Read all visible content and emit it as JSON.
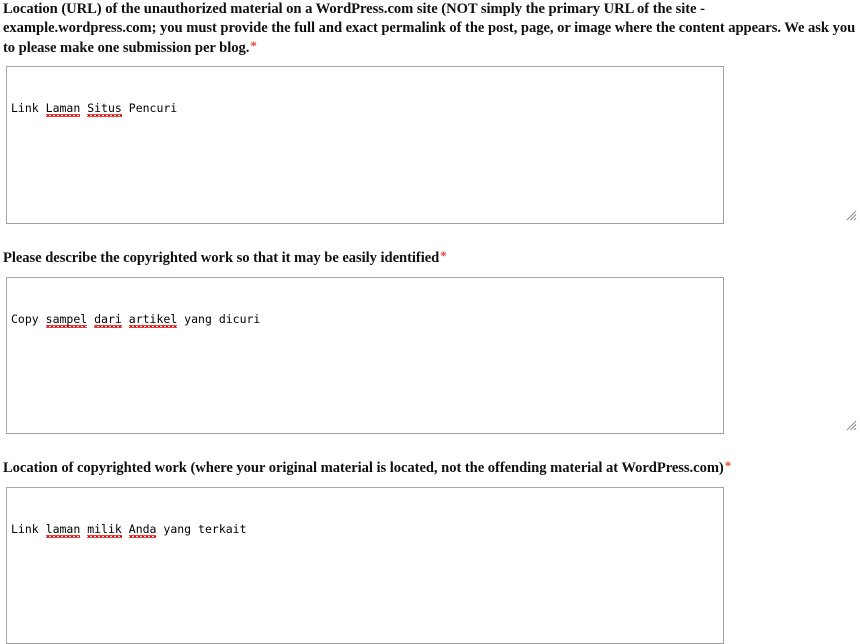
{
  "page": {
    "title": "WordPress.com DMCA Notice Form",
    "required_marker": "*",
    "accent_required_color": "#e8453c",
    "border_color": "#a3a3a3",
    "spellcheck_underline_color": "#e00000",
    "background_color": "#ffffff"
  },
  "fields": [
    {
      "id": "unauthorized-material-url",
      "label": "Location (URL) of the unauthorized material on a WordPress.com site (NOT simply the primary URL of the site - example.wordpress.com; you must provide the full and exact permalink of the post, page, or image where the content appears. We ask you to please make one submission per blog.",
      "required": true,
      "value": "Link Laman Situs Pencuri",
      "value_tokens": [
        {
          "text": "Link",
          "misspelled": false
        },
        {
          "text": " ",
          "misspelled": false
        },
        {
          "text": "Laman",
          "misspelled": true
        },
        {
          "text": " ",
          "misspelled": false
        },
        {
          "text": "Situs",
          "misspelled": true
        },
        {
          "text": " ",
          "misspelled": false
        },
        {
          "text": "Pencuri",
          "misspelled": false
        }
      ],
      "placeholder": ""
    },
    {
      "id": "copyrighted-work-description",
      "label": "Please describe the copyrighted work so that it may be easily identified",
      "required": true,
      "value": "Copy sampel dari artikel yang dicuri",
      "value_tokens": [
        {
          "text": "Copy",
          "misspelled": false
        },
        {
          "text": " ",
          "misspelled": false
        },
        {
          "text": "sampel",
          "misspelled": true
        },
        {
          "text": " ",
          "misspelled": false
        },
        {
          "text": "dari",
          "misspelled": true
        },
        {
          "text": " ",
          "misspelled": false
        },
        {
          "text": "artikel",
          "misspelled": true
        },
        {
          "text": " ",
          "misspelled": false
        },
        {
          "text": "yang",
          "misspelled": false
        },
        {
          "text": " ",
          "misspelled": false
        },
        {
          "text": "dicuri",
          "misspelled": false
        }
      ],
      "placeholder": ""
    },
    {
      "id": "copyrighted-work-location",
      "label": "Location of copyrighted work (where your original material is located, not the offending material at WordPress.com)",
      "required": true,
      "value": "Link laman milik Anda yang terkait",
      "value_tokens": [
        {
          "text": "Link",
          "misspelled": false
        },
        {
          "text": " ",
          "misspelled": false
        },
        {
          "text": "laman",
          "misspelled": true
        },
        {
          "text": " ",
          "misspelled": false
        },
        {
          "text": "milik",
          "misspelled": true
        },
        {
          "text": " ",
          "misspelled": false
        },
        {
          "text": "Anda",
          "misspelled": true
        },
        {
          "text": " ",
          "misspelled": false
        },
        {
          "text": "yang",
          "misspelled": false
        },
        {
          "text": " ",
          "misspelled": false
        },
        {
          "text": "terkait",
          "misspelled": false
        }
      ],
      "placeholder": ""
    }
  ]
}
